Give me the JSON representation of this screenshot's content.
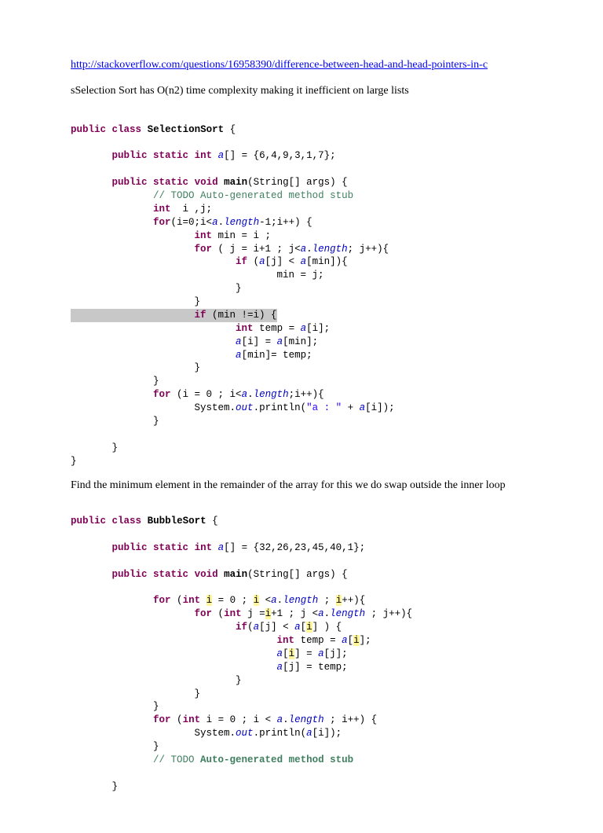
{
  "link": {
    "url": "http://stackoverflow.com/questions/16958390/difference-between-head-and-head-pointers-in-c"
  },
  "text": {
    "selectionNote": "sSelection Sort has O(n2) time complexity making it inefficient on large lists",
    "bubbleNote": "Find the minimum element in the remainder of the array for this we do swap outside the inner loop"
  },
  "code1": {
    "class": "SelectionSort",
    "array": "{6,4,9,3,1,7}",
    "todo": "// TODO Auto-generated method stub",
    "println": "\"a : \""
  },
  "code2": {
    "class": "BubbleSort",
    "array": "{32,26,23,45,40,1}",
    "todo": "// TODO Auto-generated method stub"
  }
}
